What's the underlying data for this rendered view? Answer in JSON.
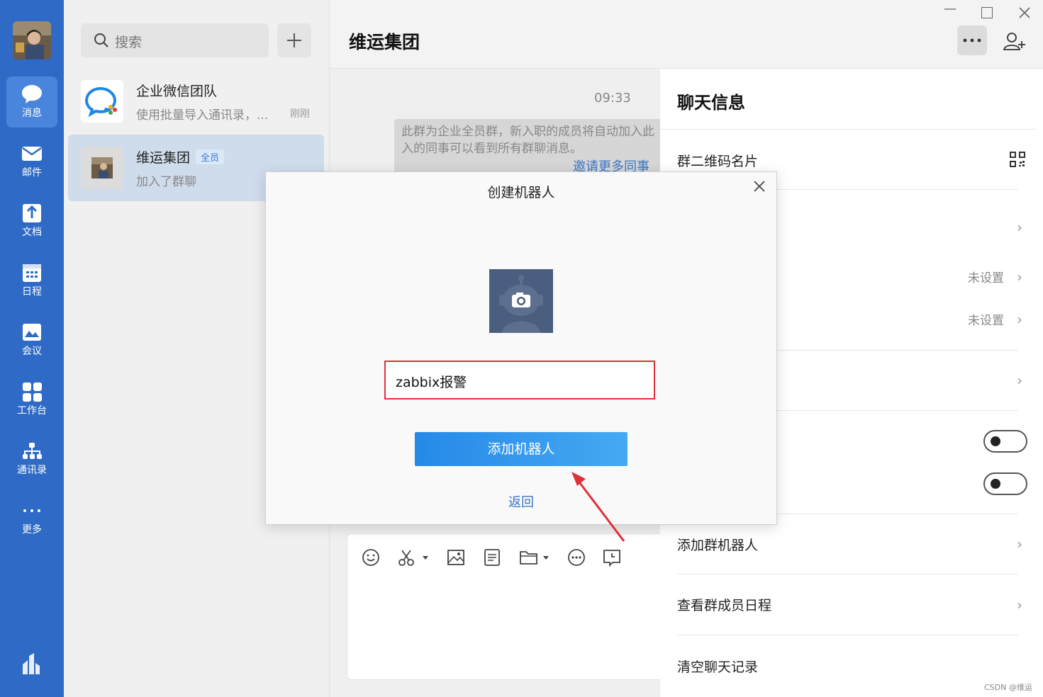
{
  "nav": {
    "items": [
      {
        "label": "消息",
        "icon": "chat-bubble-icon"
      },
      {
        "label": "邮件",
        "icon": "mail-icon"
      },
      {
        "label": "文档",
        "icon": "document-icon"
      },
      {
        "label": "日程",
        "icon": "calendar-icon"
      },
      {
        "label": "会议",
        "icon": "meeting-icon"
      },
      {
        "label": "工作台",
        "icon": "grid-icon"
      },
      {
        "label": "通讯录",
        "icon": "contacts-icon"
      },
      {
        "label": "更多",
        "icon": "more-dots-icon"
      }
    ]
  },
  "search": {
    "placeholder": "搜索"
  },
  "conversations": [
    {
      "name": "企业微信团队",
      "preview": "使用批量导入通讯录，...",
      "time": "刚刚"
    },
    {
      "name": "维运集团",
      "badge": "全员",
      "preview": "加入了群聊"
    }
  ],
  "chat": {
    "title": "维运集团",
    "time": "09:33",
    "system_message": "此群为企业全员群，新入职的成员将自动加入此群，入的同事可以看到所有群聊消息。",
    "system_line1": "此群为企业全员群，新入职的成员将自动加入此",
    "system_line2": "入的同事可以看到所有群聊消息。",
    "invite_link": "邀请更多同事"
  },
  "info_panel": {
    "title": "聊天信息",
    "qr_label": "群二维码名片",
    "unset_1": "未设置",
    "unset_2": "未设置",
    "add_robot": "添加群机器人",
    "view_schedule": "查看群成员日程",
    "clear_history": "清空聊天记录"
  },
  "dialog": {
    "title": "创建机器人",
    "robot_name": "zabbix报警",
    "add_button": "添加机器人",
    "back": "返回"
  },
  "watermark": "CSDN @维运",
  "colors": {
    "nav_bg": "#2f6bc6",
    "accent": "#2589e8",
    "highlight_border": "#e0303a",
    "arrow": "#e0303a"
  }
}
